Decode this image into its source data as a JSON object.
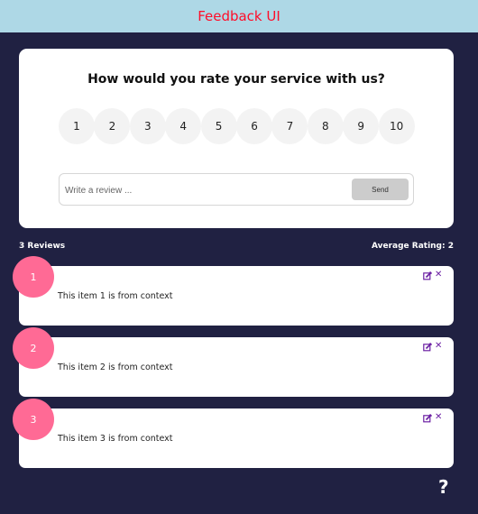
{
  "header": {
    "title": "Feedback UI"
  },
  "rating_card": {
    "question": "How would you rate your service with us?",
    "options": [
      "1",
      "2",
      "3",
      "4",
      "5",
      "6",
      "7",
      "8",
      "9",
      "10"
    ],
    "review_placeholder": "Write a review ...",
    "send_label": "Send"
  },
  "stats": {
    "count_text": "3 Reviews",
    "average_text": "Average Rating: 2"
  },
  "reviews": [
    {
      "rating": "1",
      "text": "This item 1 is from context"
    },
    {
      "rating": "2",
      "text": "This item 2 is from context"
    },
    {
      "rating": "3",
      "text": "This item 3 is from context"
    }
  ],
  "icons": {
    "edit": "edit-icon",
    "delete": "close-icon",
    "help": "question-mark-icon"
  },
  "colors": {
    "background": "#202142",
    "header_bg": "#aed8e6",
    "title_red": "#ff0d29",
    "badge_pink": "#ff6a95",
    "action_purple": "#6b1fa3"
  }
}
